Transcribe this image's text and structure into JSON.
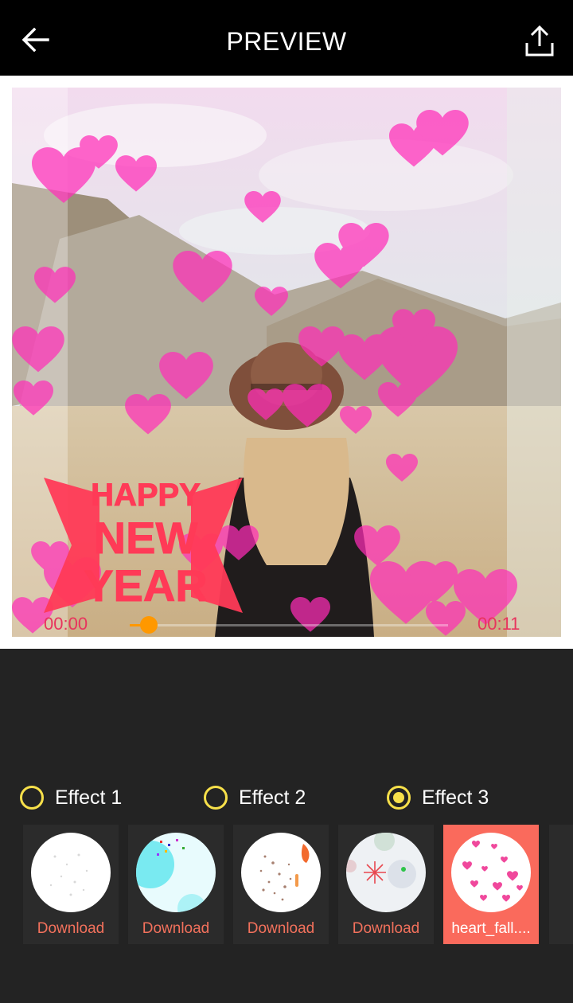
{
  "header": {
    "title": "PREVIEW",
    "back_icon": "arrow-left-icon",
    "share_icon": "share-upload-icon"
  },
  "preview": {
    "current_time": "00:00",
    "total_time": "00:11",
    "progress": 0.06,
    "overlay_text": [
      "HAPPY",
      "NEW",
      "YEAR"
    ],
    "accent_color": "#ff9800",
    "time_color": "#e8345d"
  },
  "effects": {
    "options": [
      {
        "label": "Effect 1",
        "checked": false
      },
      {
        "label": "Effect 2",
        "checked": false
      },
      {
        "label": "Effect 3",
        "checked": true
      }
    ],
    "radio_color": "#f7e04a"
  },
  "templates": [
    {
      "label": "Download",
      "icon": "sparkle-dots-thumbnail",
      "selected": false
    },
    {
      "label": "Download",
      "icon": "confetti-bokeh-thumbnail",
      "selected": false
    },
    {
      "label": "Download",
      "icon": "falling-particles-thumbnail",
      "selected": false
    },
    {
      "label": "Download",
      "icon": "firework-burst-thumbnail",
      "selected": false
    },
    {
      "label": "heart_fall....",
      "icon": "falling-hearts-thumbnail",
      "selected": true
    }
  ]
}
